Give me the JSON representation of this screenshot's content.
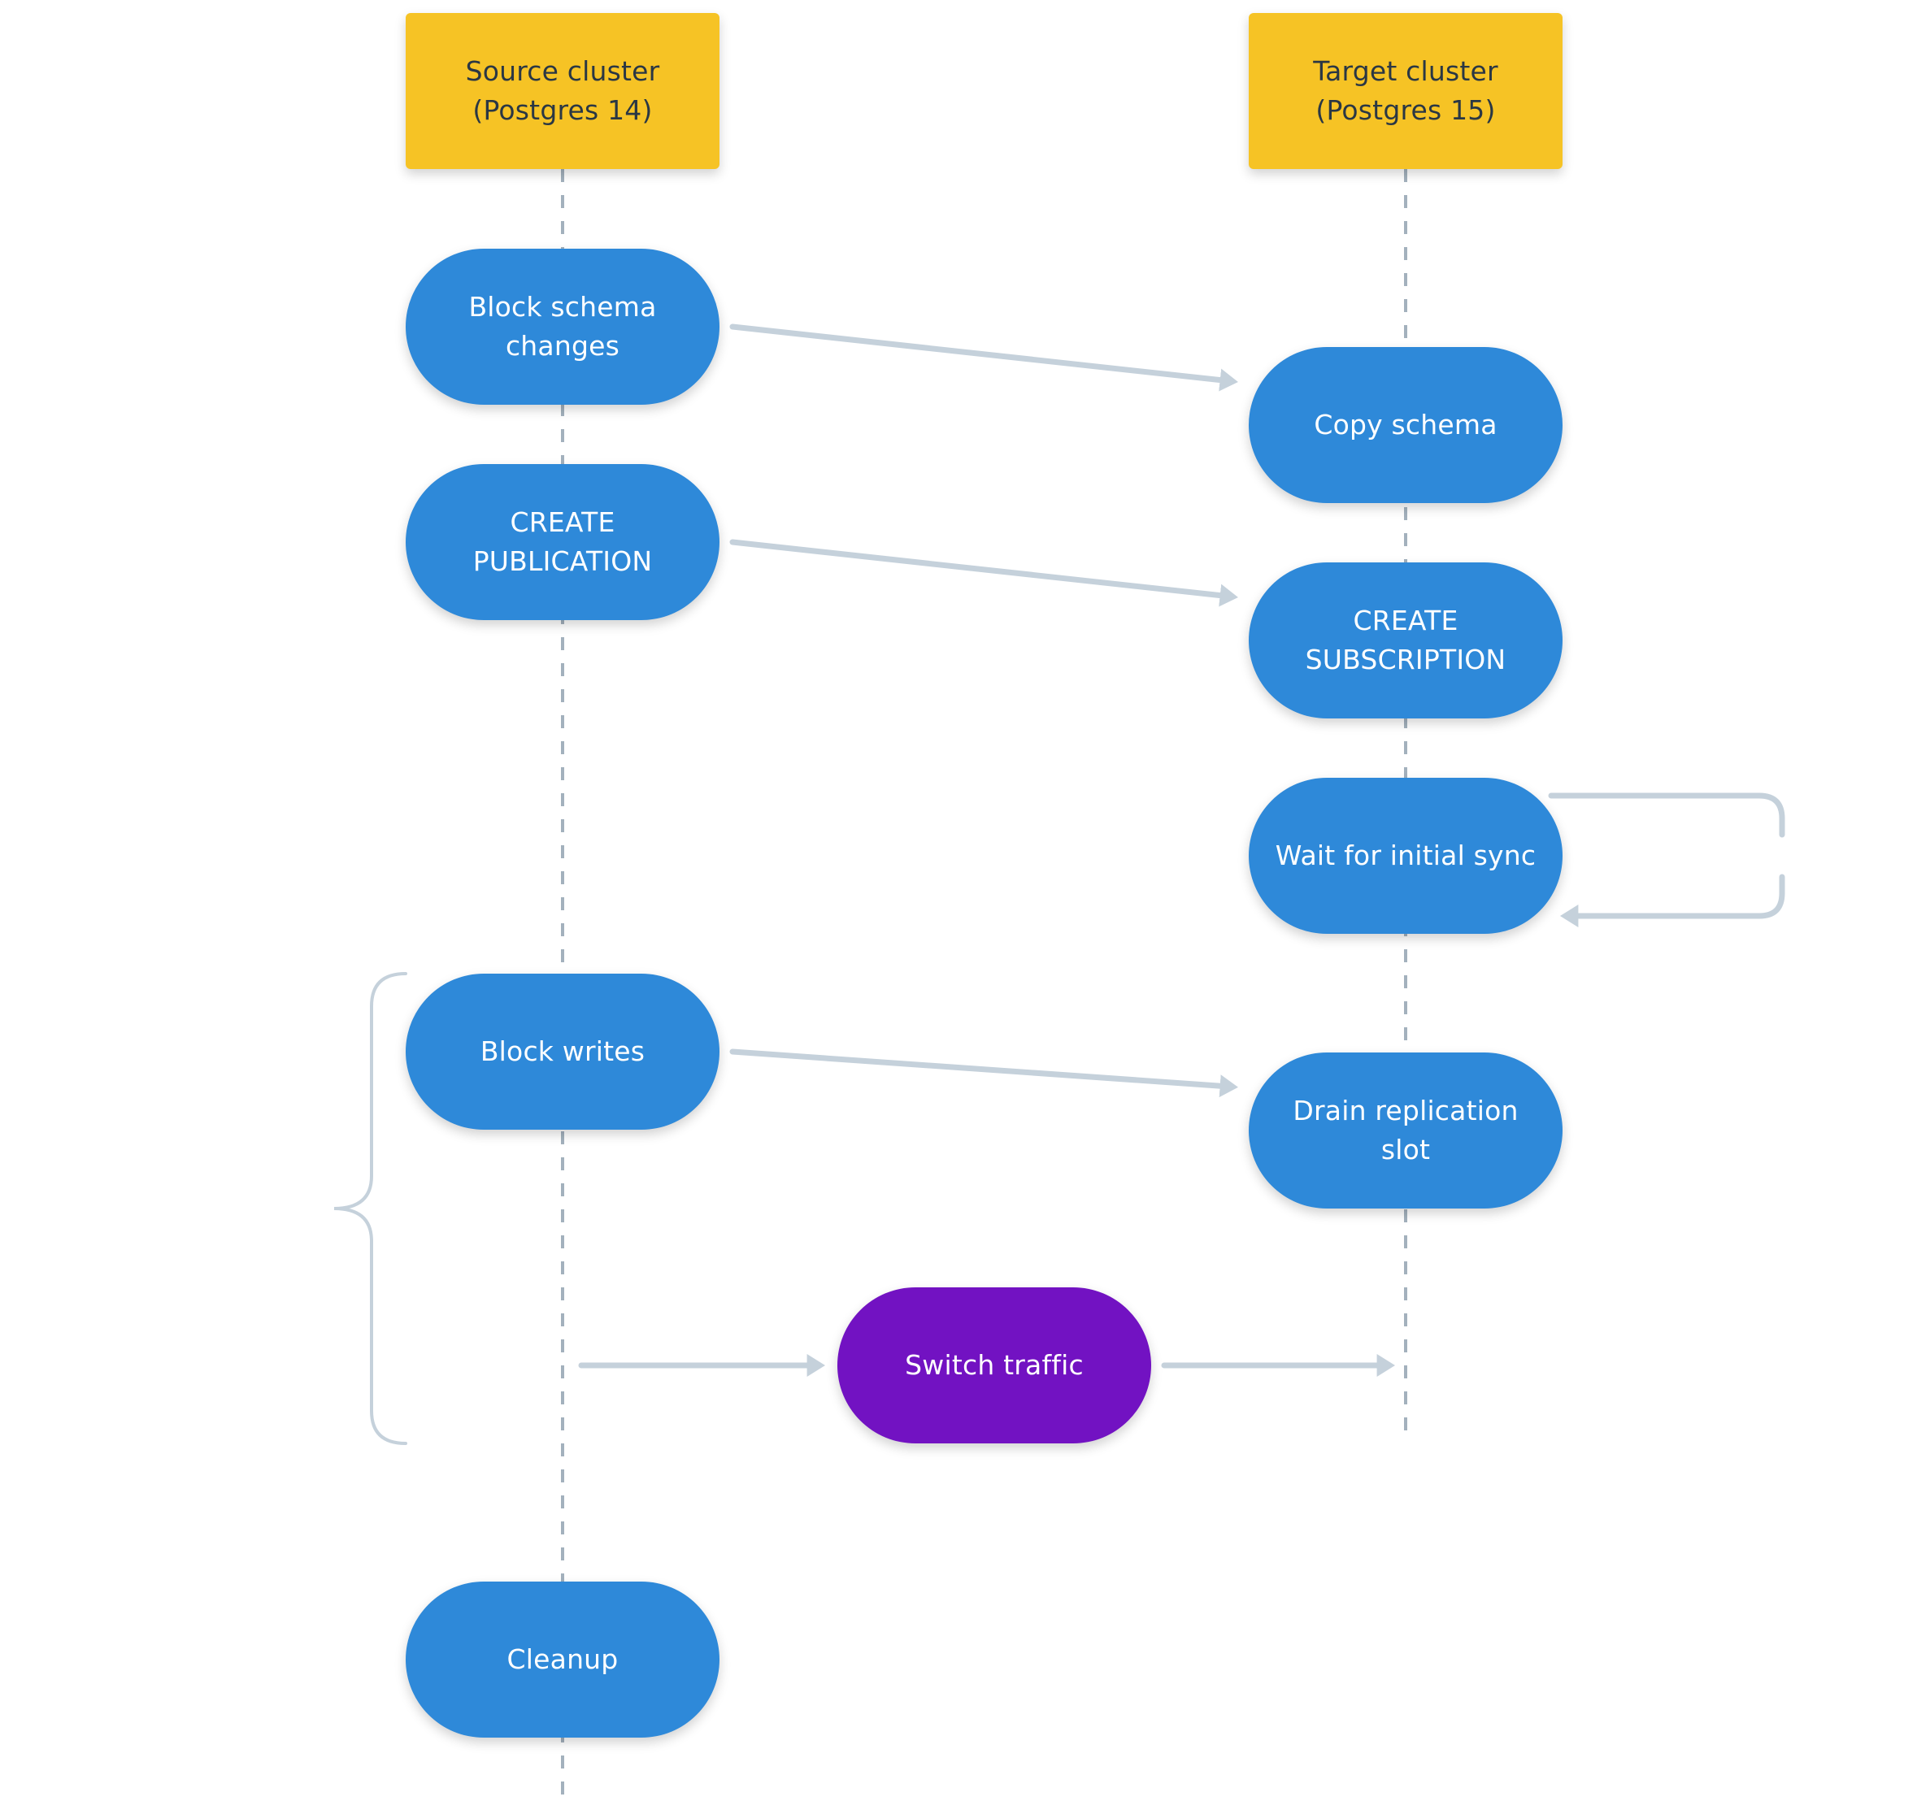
{
  "diagram": {
    "type": "swimlane-sequence",
    "colors": {
      "header": "#F6C325",
      "header_text": "#2a3744",
      "step": "#2E89D9",
      "highlight": "#7212C2",
      "arrow": "#C5D1DB",
      "lifeline": "#A3B1BD",
      "step_text": "#FFFFFF"
    },
    "lanes": [
      {
        "id": "source",
        "label": "Source cluster\n(Postgres 14)"
      },
      {
        "id": "target",
        "label": "Target cluster\n(Postgres 15)"
      }
    ],
    "steps": [
      {
        "id": "block-schema-changes",
        "lane": "source",
        "label": "Block schema\nchanges",
        "style": "step"
      },
      {
        "id": "copy-schema",
        "lane": "target",
        "label": "Copy schema",
        "style": "step"
      },
      {
        "id": "create-publication",
        "lane": "source",
        "label": "CREATE\nPUBLICATION",
        "style": "step"
      },
      {
        "id": "create-subscription",
        "lane": "target",
        "label": "CREATE\nSUBSCRIPTION",
        "style": "step"
      },
      {
        "id": "wait-initial-sync",
        "lane": "target",
        "label": "Wait for initial sync",
        "style": "step"
      },
      {
        "id": "block-writes",
        "lane": "source",
        "label": "Block writes",
        "style": "step"
      },
      {
        "id": "drain-replication-slot",
        "lane": "target",
        "label": "Drain replication slot",
        "style": "step"
      },
      {
        "id": "switch-traffic",
        "lane": "between",
        "label": "Switch traffic",
        "style": "highlight"
      },
      {
        "id": "cleanup",
        "lane": "source",
        "label": "Cleanup",
        "style": "step"
      }
    ],
    "edges": [
      {
        "from": "block-schema-changes",
        "to": "copy-schema",
        "kind": "arrow"
      },
      {
        "from": "create-publication",
        "to": "create-subscription",
        "kind": "arrow"
      },
      {
        "from": "wait-initial-sync",
        "to": "wait-initial-sync",
        "kind": "loop"
      },
      {
        "from": "block-writes",
        "to": "drain-replication-slot",
        "kind": "arrow"
      },
      {
        "from": "source",
        "to": "switch-traffic",
        "kind": "arrow"
      },
      {
        "from": "switch-traffic",
        "to": "target",
        "kind": "arrow"
      }
    ],
    "groups": [
      {
        "id": "write-downtime",
        "spans": [
          "block-writes",
          "switch-traffic"
        ],
        "shape": "curly-brace"
      }
    ]
  }
}
